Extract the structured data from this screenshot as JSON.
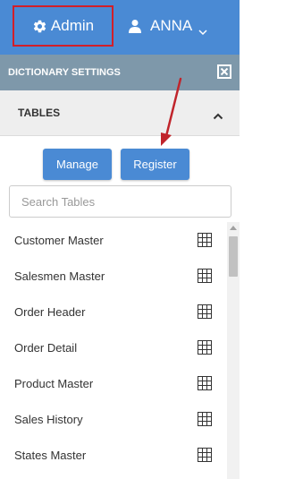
{
  "topbar": {
    "admin_label": "Admin",
    "user_label": "ANNA",
    "colors": {
      "bar": "#4a8ad4",
      "highlight_box": "#d21f29"
    }
  },
  "panel": {
    "title": "DICTIONARY SETTINGS",
    "color": "#7e98aa"
  },
  "section": {
    "title": "TABLES"
  },
  "buttons": {
    "manage": "Manage",
    "register": "Register"
  },
  "search": {
    "placeholder": "Search Tables",
    "value": ""
  },
  "tables": [
    {
      "label": "Customer Master"
    },
    {
      "label": "Salesmen Master"
    },
    {
      "label": "Order Header"
    },
    {
      "label": "Order Detail"
    },
    {
      "label": "Product Master"
    },
    {
      "label": "Sales History"
    },
    {
      "label": "States Master"
    }
  ],
  "icons": {
    "admin": "gear-icon",
    "user": "user-icon",
    "user_menu": "chevron-down-icon",
    "panel_close": "close-icon",
    "section_toggle": "chevron-up-icon",
    "table_row": "grid-icon",
    "annotation": "arrow-pointer"
  },
  "annotation_color": "#c0242b"
}
